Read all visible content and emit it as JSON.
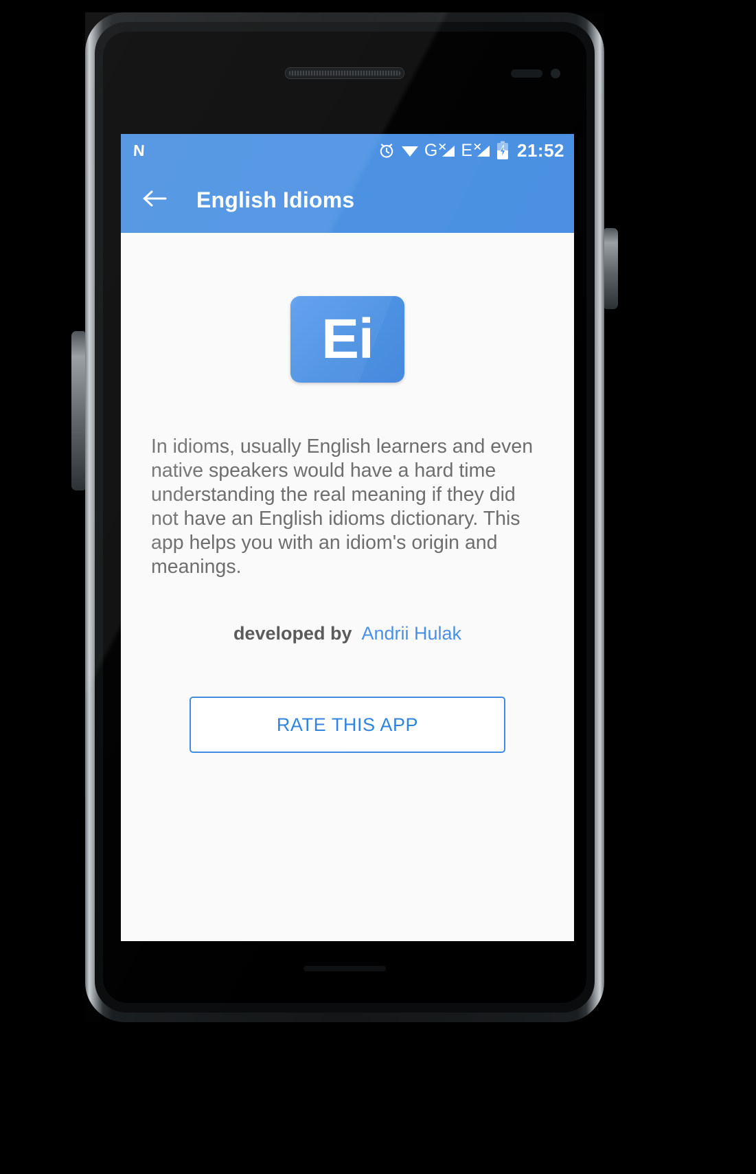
{
  "device": {
    "name": "android-phone-mockup",
    "earpiece": "earpiece-speaker",
    "front_camera": "front-camera"
  },
  "status_bar": {
    "os_logo": "N",
    "time": "21:52",
    "icons": [
      {
        "name": "alarm-icon",
        "label": "alarm"
      },
      {
        "name": "wifi-icon",
        "label": "wifi"
      },
      {
        "name": "gprs-signal-icon",
        "label": "G"
      },
      {
        "name": "edge-signal-icon",
        "label": "E"
      },
      {
        "name": "battery-charging-icon",
        "label": "battery"
      }
    ],
    "background_color": "#4a90e2"
  },
  "app_bar": {
    "back_icon": "back-arrow-icon",
    "title": "English Idioms",
    "background_color": "#4a90e2",
    "title_color": "#ffffff"
  },
  "content": {
    "app_icon": {
      "text": "Ei",
      "background_color": "#4a90e2",
      "text_color": "#ffffff"
    },
    "description": "In idioms, usually English learners and even native speakers would have a hard time understanding the real meaning if they did not have an English idioms dictionary. This app helps you with an idiom's origin and meanings.",
    "credit": {
      "label": "developed by",
      "developer_name": "Andrii Hulak",
      "link_color": "#4a90e2"
    },
    "rate_button": {
      "label": "RATE THIS APP",
      "text_color": "#2f84de",
      "border_color": "#3f8ae0"
    },
    "background_color": "#fafafa"
  }
}
